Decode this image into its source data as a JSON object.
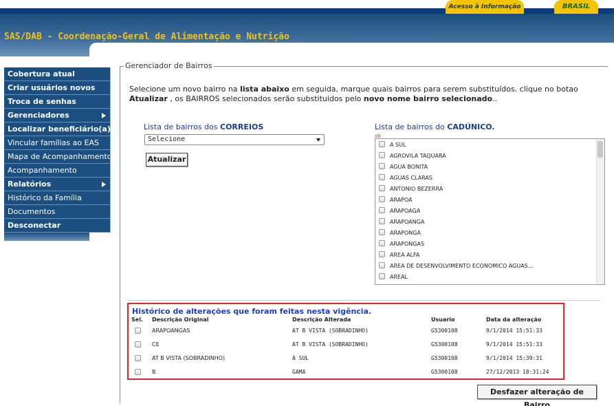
{
  "gov_bar": {
    "acesso": "Acesso à Informação",
    "brasil": "BRASIL"
  },
  "header": {
    "title": "SAS/DAB - Coordenação-Geral de Alimentação e Nutrição"
  },
  "sidebar": {
    "items": [
      {
        "label": "Cobertura atual",
        "bold": true,
        "submenu": false
      },
      {
        "label": "Criar usuários novos",
        "bold": true,
        "submenu": false
      },
      {
        "label": "Troca de senhas",
        "bold": true,
        "submenu": false
      },
      {
        "label": "Gerenciadores",
        "bold": true,
        "submenu": true
      },
      {
        "label": "Localizar beneficiário(a)",
        "bold": true,
        "submenu": false
      },
      {
        "label": "Vincular famílias ao EAS",
        "bold": false,
        "submenu": false
      },
      {
        "label": "Mapa de Acompanhamento",
        "bold": false,
        "submenu": false
      },
      {
        "label": "Acompanhamento",
        "bold": false,
        "submenu": false
      },
      {
        "label": "Relatórios",
        "bold": true,
        "submenu": true
      },
      {
        "label": "Histórico da Família",
        "bold": false,
        "submenu": false
      },
      {
        "label": "Documentos",
        "bold": false,
        "submenu": false
      },
      {
        "label": "Desconectar",
        "bold": true,
        "submenu": false
      }
    ]
  },
  "main": {
    "legend": "Gerenciador de Bairros",
    "instructions": {
      "p1": "Selecione um novo bairro na ",
      "b1": "lista abaixo",
      "p2": " em seguida, marque quais bairros para serem substituídos. clique no botao",
      "b2": "Atualizar",
      "p3": " , os BAIRROS selecionados serão substituidos pelo ",
      "b3": "novo nome bairro selecionado",
      "p4": ".."
    },
    "correios": {
      "label_prefix": "Lista de bairros dos ",
      "label_bold": "CORREIOS",
      "select_value": "Selecione",
      "update_button": "Atualizar"
    },
    "cadunico": {
      "label_prefix": "Lista de bairros do ",
      "label_bold": "CADÚNICO.",
      "ok_text": "ok",
      "options": [
        "A SUL",
        "AGROVILA TAQUARA",
        "AGUA BONITA",
        "AGUAS CLARAS",
        "ANTONIO BEZERRA",
        "ARAPOA",
        "ARAPOAGA",
        "ARAPOANGA",
        "ARAPONGA",
        "ARAPONGAS",
        "AREA ALFA",
        "AREA DE DESENVOLVIMENTO ECONOMICO AGUAS...",
        "AREAL"
      ]
    },
    "history": {
      "title": "Histórico de alterações que foram feitas nesta vigência.",
      "columns": [
        "Sel.",
        "Descrição Original",
        "Descrição Alterada",
        "Usuario",
        "Data da alteração"
      ],
      "rows": [
        {
          "original": "ARAPOANGAS",
          "alterada": "AT B VISTA (SOBRADINHO)",
          "usuario": "G5300108",
          "data": "9/1/2014 15:51:33"
        },
        {
          "original": "CE",
          "alterada": "AT B VISTA (SOBRADINHO)",
          "usuario": "G5300108",
          "data": "9/1/2014 15:51:33"
        },
        {
          "original": "AT B VISTA (SOBRADINHO)",
          "alterada": "A SUL",
          "usuario": "G5300108",
          "data": "9/1/2014 15:39:31"
        },
        {
          "original": "B",
          "alterada": "GAMA",
          "usuario": "G5300108",
          "data": "27/12/2013 18:31:24"
        }
      ]
    },
    "undo_button": "Desfazer alteração de Bairro"
  }
}
